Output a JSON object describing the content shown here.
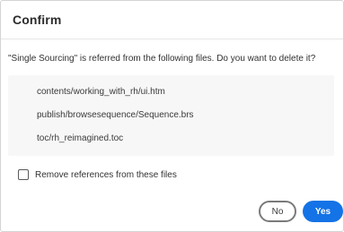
{
  "dialog": {
    "title": "Confirm",
    "message": "\"Single Sourcing\" is referred from the following files. Do you want to delete it?",
    "files": [
      "contents/working_with_rh/ui.htm",
      "publish/browsesequence/Sequence.brs",
      "toc/rh_reimagined.toc"
    ],
    "remove_references": {
      "label": "Remove references from these files",
      "checked": false
    },
    "buttons": {
      "no_label": "No",
      "yes_label": "Yes"
    }
  },
  "colors": {
    "primary_button": "#1473e6",
    "list_background": "#f7f7f7"
  }
}
